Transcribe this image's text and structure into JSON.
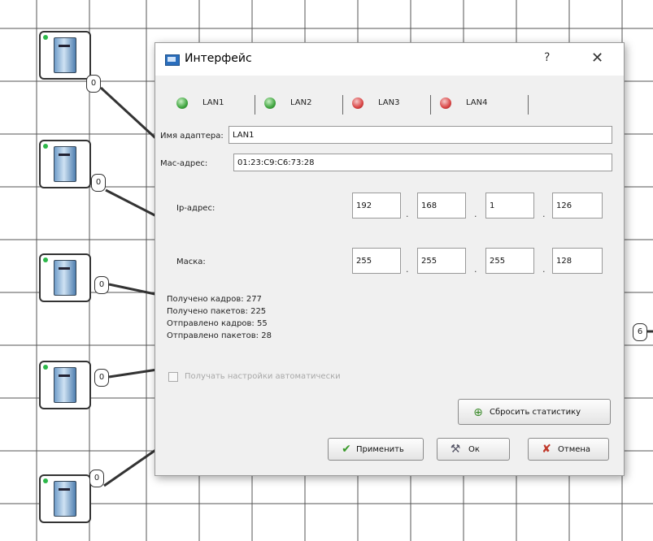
{
  "canvas": {
    "ports": [
      "0",
      "0",
      "0",
      "0",
      "0",
      "6"
    ]
  },
  "dialog": {
    "title": "Интерфейс",
    "help": "?",
    "close": "✕",
    "tabs": [
      {
        "label": "LAN1",
        "status": "ok"
      },
      {
        "label": "LAN2",
        "status": "ok"
      },
      {
        "label": "LAN3",
        "status": "off"
      },
      {
        "label": "LAN4",
        "status": "off"
      }
    ],
    "adapter_name_label": "Имя адаптера:",
    "adapter_name_value": "LAN1",
    "mac_label": "Mac-адрес:",
    "mac_value": "01:23:C9:C6:73:28",
    "ip_label": "Ip-адрес:",
    "ip": [
      "192",
      "168",
      "1",
      "126"
    ],
    "mask_label": "Маска:",
    "mask": [
      "255",
      "255",
      "255",
      "128"
    ],
    "octet_sep": ".",
    "stats": {
      "frames_received": "Получено кадров: 277",
      "packets_received": "Получено пакетов: 225",
      "frames_sent": "Отправлено кадров: 55",
      "packets_sent": "Отправлено пакетов: 28"
    },
    "auto_config_label": "Получать настройки автоматически",
    "reset_stats_label": "Сбросить статистику",
    "apply_label": "Применить",
    "ok_label": "Ок",
    "cancel_label": "Отмена"
  }
}
